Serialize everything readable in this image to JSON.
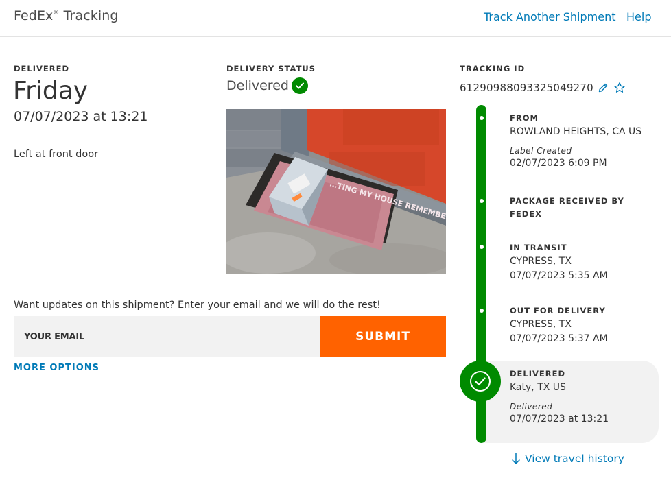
{
  "header": {
    "brand": "FedEx",
    "brand_mark": "®",
    "brand_suffix": "Tracking",
    "nav": [
      {
        "label": "Track Another Shipment"
      },
      {
        "label": "Help"
      }
    ]
  },
  "summary": {
    "delivered_label": "DELIVERED",
    "day": "Friday",
    "datetime": "07/07/2023 at 13:21",
    "note": "Left at front door"
  },
  "status": {
    "label": "DELIVERY STATUS",
    "value": "Delivered",
    "photo_mat_text": "…TING MY HOUSE REMEMBER"
  },
  "updates": {
    "prompt": "Want updates on this shipment? Enter your email and we will do the rest!",
    "email_placeholder": "YOUR EMAIL",
    "submit_label": "SUBMIT",
    "more_options": "MORE OPTIONS"
  },
  "tracking": {
    "label": "TRACKING ID",
    "id": "61290988093325049270"
  },
  "timeline": {
    "from": {
      "title": "FROM",
      "location": "ROWLAND HEIGHTS, CA US",
      "sub_label": "Label Created",
      "datetime": "02/07/2023 6:09 PM"
    },
    "received": {
      "title_line1": "PACKAGE RECEIVED BY",
      "title_line2": "FEDEX"
    },
    "in_transit": {
      "title": "IN TRANSIT",
      "location": "CYPRESS, TX",
      "datetime": "07/07/2023 5:35 AM"
    },
    "out_for_delivery": {
      "title": "OUT FOR DELIVERY",
      "location": "CYPRESS, TX",
      "datetime": "07/07/2023 5:37 AM"
    },
    "delivered": {
      "title": "DELIVERED",
      "location": "Katy, TX US",
      "sub_label": "Delivered",
      "datetime": "07/07/2023 at 13:21"
    }
  },
  "view_history": "View travel history",
  "colors": {
    "fedex_green": "#008a00",
    "fedex_orange": "#ff6200",
    "link_blue": "#007ab7"
  },
  "icons": [
    "check-circle-icon",
    "pencil-icon",
    "star-icon",
    "arrow-down-icon"
  ]
}
